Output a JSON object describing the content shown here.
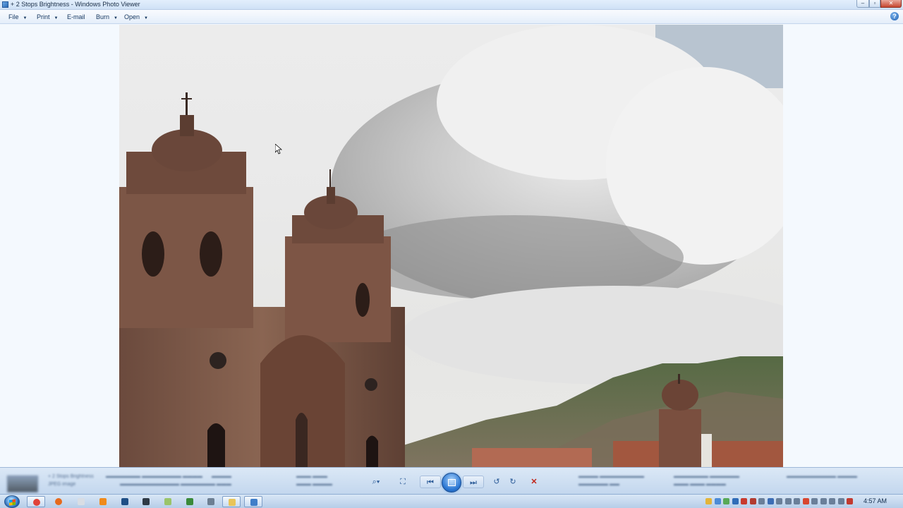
{
  "window": {
    "title": "+ 2 Stops Brightness - Windows Photo Viewer",
    "controls": [
      "minimize",
      "maximize",
      "close"
    ]
  },
  "menu": {
    "items": [
      {
        "label": "File",
        "has_dropdown": true
      },
      {
        "label": "Print",
        "has_dropdown": true
      },
      {
        "label": "E-mail",
        "has_dropdown": false
      },
      {
        "label": "Burn",
        "has_dropdown": true
      },
      {
        "label": "Open",
        "has_dropdown": true
      }
    ],
    "help_label": "?"
  },
  "photo": {
    "subject": "Colonial church towers under a cloudy sky with green hills",
    "icon_name": "photo-image"
  },
  "info_panel_blurred": {
    "filename": "+ 2 Stops Brightness",
    "line2": "JPEG image"
  },
  "navigation": {
    "zoom_icon": "magnifier-icon",
    "actual_size_icon": "fit-window-icon",
    "previous_icon": "previous-icon",
    "slideshow_icon": "play-slideshow-icon",
    "next_icon": "next-icon",
    "rotate_ccw_icon": "rotate-counterclockwise-icon",
    "rotate_cw_icon": "rotate-clockwise-icon",
    "delete_icon": "delete-icon"
  },
  "taskbar": {
    "pinned": [
      {
        "name": "chrome-icon",
        "color": "#e0433a"
      },
      {
        "name": "firefox-icon",
        "color": "#e66a1d"
      },
      {
        "name": "explorer-blank-icon",
        "color": "#d8dde4"
      },
      {
        "name": "app-orange-icon",
        "color": "#f08a1a"
      },
      {
        "name": "photoshop-icon",
        "color": "#1f4f86"
      },
      {
        "name": "terminal-icon",
        "color": "#2f3a46"
      },
      {
        "name": "notes-icon",
        "color": "#9ac46a"
      },
      {
        "name": "green-app-icon",
        "color": "#3a8a3a"
      },
      {
        "name": "calculator-icon",
        "color": "#6d7f93"
      },
      {
        "name": "folder-icon",
        "color": "#e8c45a"
      },
      {
        "name": "photo-viewer-icon",
        "color": "#3f7ec9"
      }
    ],
    "clock": "4:57 AM"
  },
  "colors": {
    "menu_text": "#15365e",
    "panel_top": "#dbe8f6",
    "accent": "#2a76d2"
  }
}
